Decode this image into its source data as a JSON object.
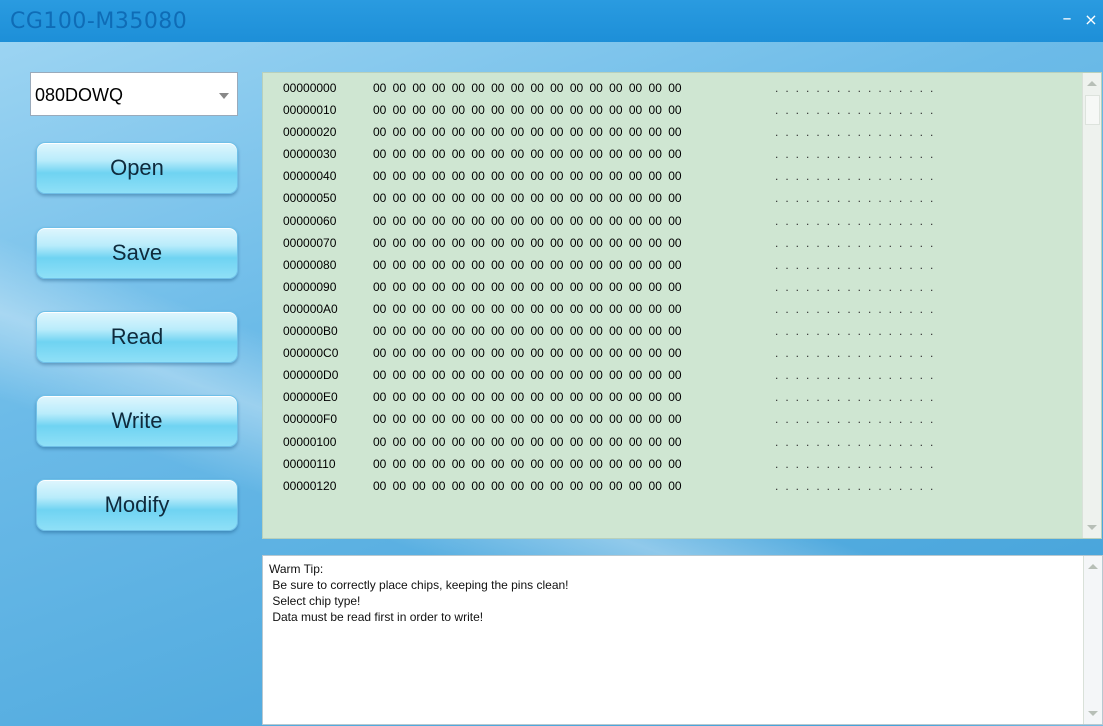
{
  "window": {
    "title": "CG100-M35080",
    "minimize_glyph": "–",
    "close_glyph": "×"
  },
  "chip_select": {
    "value": "080DOWQ"
  },
  "buttons": {
    "open": "Open",
    "save": "Save",
    "read": "Read",
    "write": "Write",
    "modify": "Modify"
  },
  "hex_view": {
    "rows": [
      {
        "address": "00000000",
        "bytes": "00 00 00 00 00 00 00 00 00 00 00 00 00 00 00 00",
        "ascii": "................"
      },
      {
        "address": "00000010",
        "bytes": "00 00 00 00 00 00 00 00 00 00 00 00 00 00 00 00",
        "ascii": "................"
      },
      {
        "address": "00000020",
        "bytes": "00 00 00 00 00 00 00 00 00 00 00 00 00 00 00 00",
        "ascii": "................"
      },
      {
        "address": "00000030",
        "bytes": "00 00 00 00 00 00 00 00 00 00 00 00 00 00 00 00",
        "ascii": "................"
      },
      {
        "address": "00000040",
        "bytes": "00 00 00 00 00 00 00 00 00 00 00 00 00 00 00 00",
        "ascii": "................"
      },
      {
        "address": "00000050",
        "bytes": "00 00 00 00 00 00 00 00 00 00 00 00 00 00 00 00",
        "ascii": "................"
      },
      {
        "address": "00000060",
        "bytes": "00 00 00 00 00 00 00 00 00 00 00 00 00 00 00 00",
        "ascii": "................"
      },
      {
        "address": "00000070",
        "bytes": "00 00 00 00 00 00 00 00 00 00 00 00 00 00 00 00",
        "ascii": "................"
      },
      {
        "address": "00000080",
        "bytes": "00 00 00 00 00 00 00 00 00 00 00 00 00 00 00 00",
        "ascii": "................"
      },
      {
        "address": "00000090",
        "bytes": "00 00 00 00 00 00 00 00 00 00 00 00 00 00 00 00",
        "ascii": "................"
      },
      {
        "address": "000000A0",
        "bytes": "00 00 00 00 00 00 00 00 00 00 00 00 00 00 00 00",
        "ascii": "................"
      },
      {
        "address": "000000B0",
        "bytes": "00 00 00 00 00 00 00 00 00 00 00 00 00 00 00 00",
        "ascii": "................"
      },
      {
        "address": "000000C0",
        "bytes": "00 00 00 00 00 00 00 00 00 00 00 00 00 00 00 00",
        "ascii": "................"
      },
      {
        "address": "000000D0",
        "bytes": "00 00 00 00 00 00 00 00 00 00 00 00 00 00 00 00",
        "ascii": "................"
      },
      {
        "address": "000000E0",
        "bytes": "00 00 00 00 00 00 00 00 00 00 00 00 00 00 00 00",
        "ascii": "................"
      },
      {
        "address": "000000F0",
        "bytes": "00 00 00 00 00 00 00 00 00 00 00 00 00 00 00 00",
        "ascii": "................"
      },
      {
        "address": "00000100",
        "bytes": "00 00 00 00 00 00 00 00 00 00 00 00 00 00 00 00",
        "ascii": "................"
      },
      {
        "address": "00000110",
        "bytes": "00 00 00 00 00 00 00 00 00 00 00 00 00 00 00 00",
        "ascii": "................"
      },
      {
        "address": "00000120",
        "bytes": "00 00 00 00 00 00 00 00 00 00 00 00 00 00 00 00",
        "ascii": "................"
      }
    ]
  },
  "tips": {
    "lines": [
      "Warm Tip:",
      " Be sure to correctly place chips, keeping the pins clean!",
      " Select chip type!",
      " Data must be read first in order to write!"
    ]
  }
}
